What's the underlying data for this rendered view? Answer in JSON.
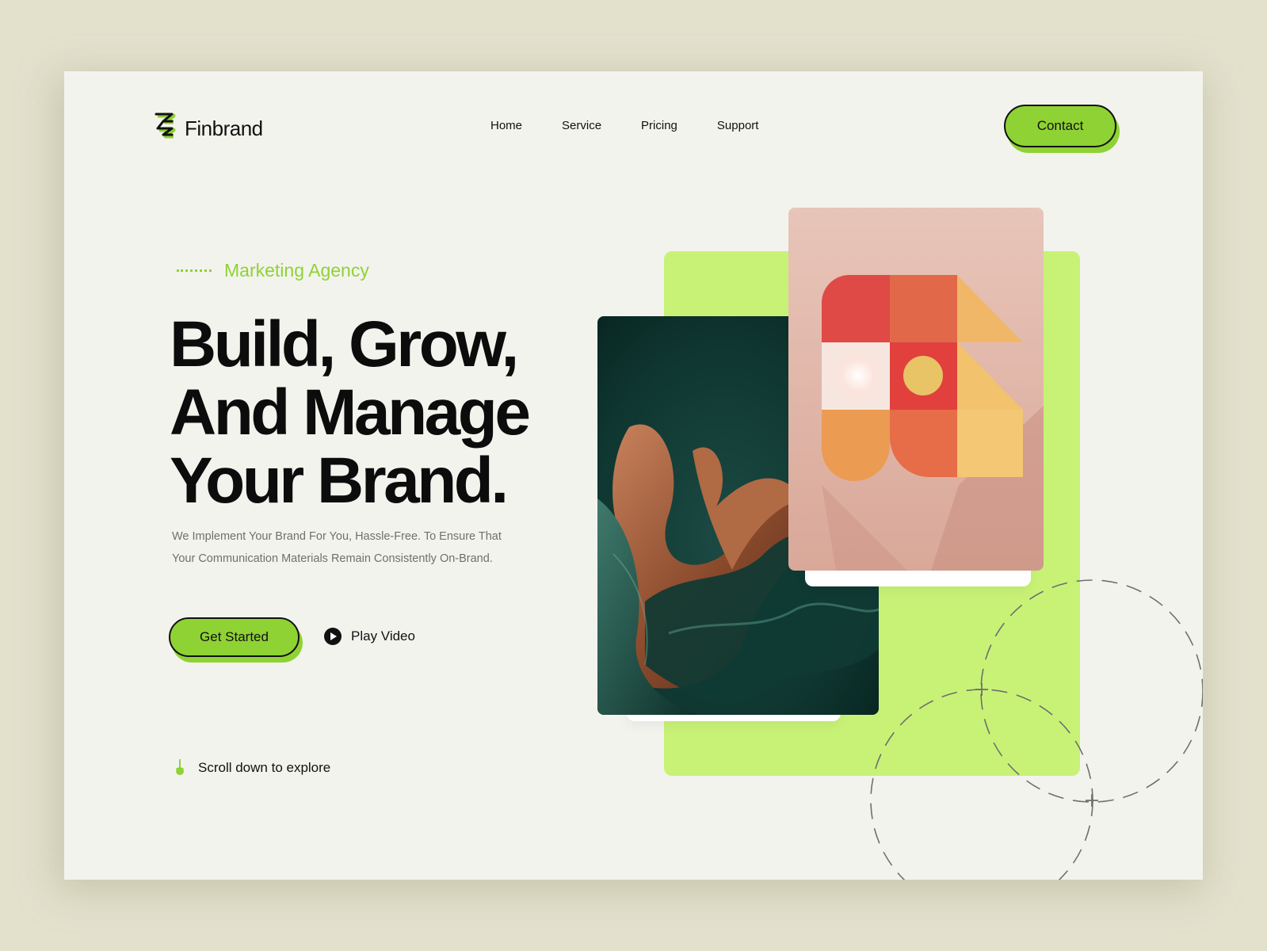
{
  "brand": {
    "name": "Finbrand",
    "accent": "#8fd234",
    "accent_light": "#c8f276",
    "text": "#111111"
  },
  "nav": {
    "items": [
      {
        "label": "Home"
      },
      {
        "label": "Service"
      },
      {
        "label": "Pricing"
      },
      {
        "label": "Support"
      }
    ],
    "contact_label": "Contact"
  },
  "hero": {
    "eyebrow": "Marketing Agency",
    "headline_lines": [
      "Build, Grow,",
      "And Manage",
      "Your Brand."
    ],
    "description_lines": [
      "We Implement Your Brand For You, Hassle-Free. To Ensure That",
      "Your Communication Materials Remain Consistently On-Brand."
    ],
    "primary_cta": "Get Started",
    "secondary_cta": "Play Video",
    "scroll_hint": "Scroll down to explore"
  },
  "icons": {
    "logo": "finbrand-logo-icon",
    "play": "play-circle-icon",
    "scroll": "arrow-down-icon"
  }
}
